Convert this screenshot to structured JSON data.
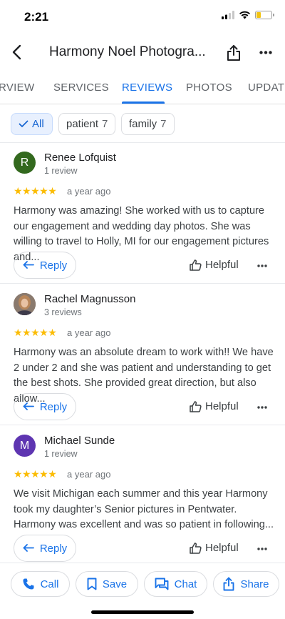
{
  "status_bar": {
    "time": "2:21",
    "battery_percent": 30
  },
  "header": {
    "title": "Harmony Noel Photogra..."
  },
  "tabs": [
    {
      "label": "RVIEW"
    },
    {
      "label": "SERVICES"
    },
    {
      "label": "REVIEWS",
      "active": true
    },
    {
      "label": "PHOTOS"
    },
    {
      "label": "UPDATE"
    }
  ],
  "chips": [
    {
      "label": "All",
      "selected": true
    },
    {
      "label": "patient",
      "count": "7"
    },
    {
      "label": "family",
      "count": "7"
    }
  ],
  "reviews": [
    {
      "avatar_letter": "R",
      "avatar_color": "#33691e",
      "name": "Renee Lofquist",
      "count": "1 review",
      "stars": "★★★★★",
      "date": "a year ago",
      "text": "Harmony was amazing! She worked with us to capture our engagement and wedding day photos. She was willing to travel to Holly, MI for our engagement pictures and...",
      "reply_label": "Reply",
      "helpful_label": "Helpful"
    },
    {
      "avatar_letter": "",
      "avatar_color": "#6d5a4e",
      "name": "Rachel Magnusson",
      "count": "3 reviews",
      "stars": "★★★★★",
      "date": "a year ago",
      "text": "Harmony was an absolute dream to work with!! We have 2 under 2 and she was patient and understanding to get the best shots. She provided great direction, but also allow...",
      "reply_label": "Reply",
      "helpful_label": "Helpful"
    },
    {
      "avatar_letter": "M",
      "avatar_color": "#5e35b1",
      "name": "Michael Sunde",
      "count": "1 review",
      "stars": "★★★★★",
      "date": "a year ago",
      "text": "We visit Michigan each summer and this year Harmony took my daughter’s Senior pictures in Pentwater. Harmony was excellent and was so patient in following...",
      "reply_label": "Reply",
      "helpful_label": "Helpful"
    }
  ],
  "actions": [
    {
      "label": "Call",
      "icon": "phone-icon"
    },
    {
      "label": "Save",
      "icon": "bookmark-icon"
    },
    {
      "label": "Chat",
      "icon": "chat-icon"
    },
    {
      "label": "Share",
      "icon": "share-icon"
    }
  ],
  "colors": {
    "accent": "#1a73e8",
    "star": "#fbbc04"
  }
}
